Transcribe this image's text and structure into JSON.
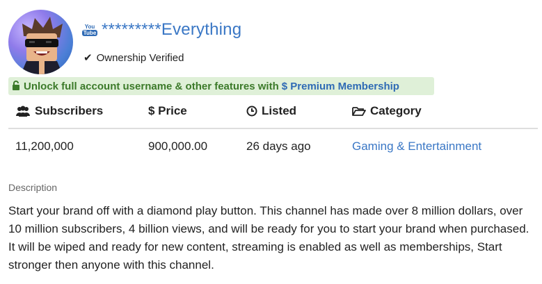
{
  "channel": {
    "platform_badge_top": "You",
    "platform_badge_bottom": "Tube",
    "name": "*********Everything",
    "verified_label": "Ownership Verified"
  },
  "promo": {
    "prefix": "Unlock full account username & other features with",
    "link": "$ Premium Membership",
    "background_color": "#dff0d8",
    "text_color": "#3c7a2a",
    "link_color": "#2f6bb5"
  },
  "table": {
    "headers": {
      "subscribers": "Subscribers",
      "price": "$ Price",
      "listed": "Listed",
      "category": "Category"
    },
    "row": {
      "subscribers": "11,200,000",
      "price": "900,000.00",
      "listed": "26 days ago",
      "category": "Gaming & Entertainment"
    }
  },
  "description": {
    "label": "Description",
    "text": "Start your brand off with a diamond play button. This channel has made over 8 million dollars, over 10 million subscribers, 4 billion views, and will be ready for you to start your brand when purchased. It will be wiped and ready for new content, streaming is enabled as well as memberships, Start stronger then anyone with this channel."
  },
  "icons": {
    "verified": "checkmark-icon",
    "promo": "unlock-icon",
    "subscribers": "users-icon",
    "listed": "clock-icon",
    "category": "folder-open-icon"
  },
  "colors": {
    "link": "#3a77c5",
    "text": "#222222"
  }
}
